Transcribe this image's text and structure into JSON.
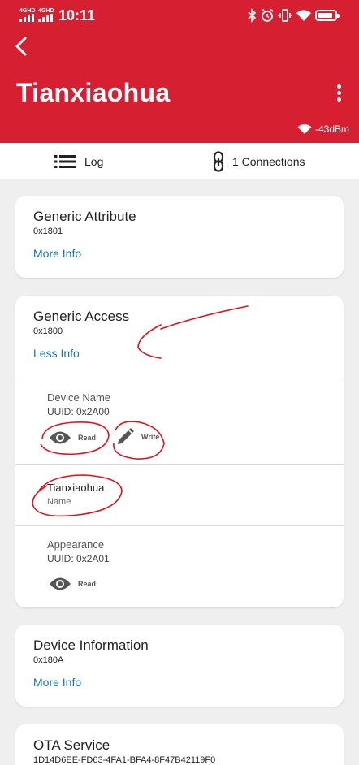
{
  "status_bar": {
    "signal_1": "4GHD",
    "signal_2": "4GHD",
    "time": "10:11",
    "battery_level": 0.9
  },
  "header": {
    "title": "Tianxiaohua",
    "rssi": "-43dBm",
    "background": "#d71f32"
  },
  "tabs": [
    {
      "label": "Log",
      "icon": "list-icon"
    },
    {
      "label": "1 Connections",
      "icon": "link-icon"
    }
  ],
  "services": [
    {
      "name": "Generic Attribute",
      "uuid": "0x1801",
      "link": "More Info"
    },
    {
      "name": "Generic Access",
      "uuid": "0x1800",
      "link": "Less Info",
      "characteristics": [
        {
          "name": "Device Name",
          "uuid_label": "UUID:",
          "uuid": "0x2A00",
          "actions": [
            "Read",
            "Write"
          ],
          "value": {
            "text": "Tianxiaohua",
            "label": "Name"
          }
        },
        {
          "name": "Appearance",
          "uuid_label": "UUID:",
          "uuid": "0x2A01",
          "actions": [
            "Read"
          ]
        }
      ]
    },
    {
      "name": "Device Information",
      "uuid": "0x180A",
      "link": "More Info"
    },
    {
      "name": "OTA Service",
      "uuid": "1D14D6EE-FD63-4FA1-BFA4-8F47B42119F0"
    }
  ],
  "colors": {
    "accent": "#d71f32",
    "link": "#1b74a8",
    "annotation": "#e0101a"
  }
}
